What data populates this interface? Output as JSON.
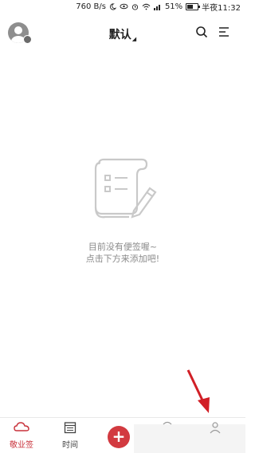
{
  "status_bar": {
    "speed": "760 B/s",
    "battery": "51%",
    "battery_level": 0.51,
    "time": "半夜11:32"
  },
  "header": {
    "title": "默认",
    "title_caret": "◢"
  },
  "empty_state": {
    "line1": "目前没有便签喔~",
    "line2": "点击下方来添加吧!"
  },
  "tabbar": {
    "tab_notes": "敬业签",
    "tab_time": "时间",
    "add_symbol": "+"
  },
  "colors": {
    "accent": "#c8313a",
    "add_button": "#d23a40"
  }
}
